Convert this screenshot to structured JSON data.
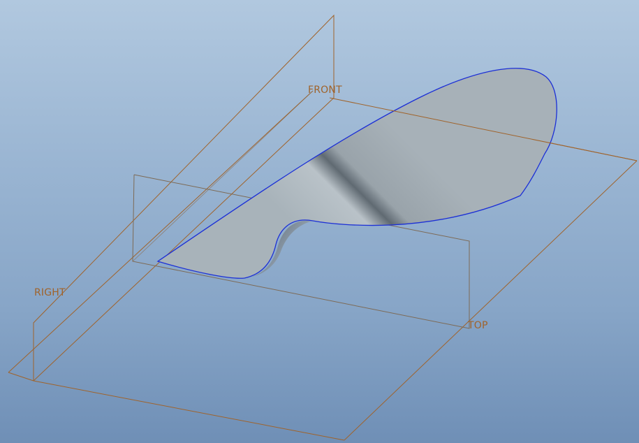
{
  "viewport": {
    "planes": {
      "front": {
        "label": "FRONT"
      },
      "right": {
        "label": "RIGHT"
      },
      "top": {
        "label": "TOP"
      }
    }
  },
  "colors": {
    "datum_plane": "#a0632a",
    "surface_edge": "#1c2fd6",
    "surface_fill": "#a9b4bc",
    "background_top": "#b1c8df",
    "background_bottom": "#6f8fb6"
  }
}
